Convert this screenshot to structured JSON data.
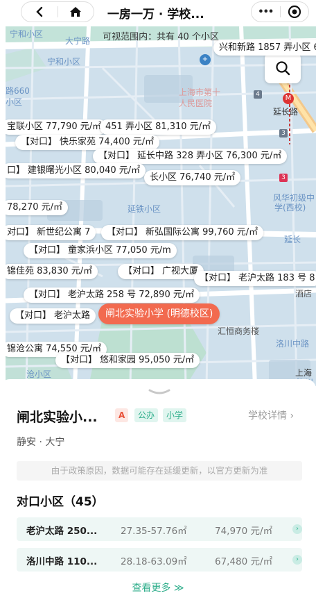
{
  "nav": {
    "title": "一房一万 · 学校...",
    "back_glyph": "<",
    "more_glyph": "•••"
  },
  "map": {
    "range_banner": "可视范围内：共有 40 个小区",
    "streets": [
      "宁和小区",
      "大宁路",
      "宁和小区",
      "路660",
      "小区",
      "上海市第十",
      "人民医院",
      "延长路",
      "延铁小区",
      "风华初级中",
      "学(西校)",
      "延长",
      "汇恒商务楼",
      "洛川中路",
      "上海",
      "酒店",
      "沧小区",
      "洛川"
    ],
    "labels": [
      {
        "text": "兴和新路 1857 弄小区 6"
      },
      {
        "text": "宝联小区 77,790 元/㎡"
      },
      {
        "text": "451 弄小区 81,310 元/㎡"
      },
      {
        "prefix": "【对口】",
        "text": "快乐家苑 74,400 元/㎡"
      },
      {
        "prefix": "【对口】",
        "text": "延长中路 328 弄小区 76,300 元/㎡"
      },
      {
        "prefix": "口】",
        "text": "建银曙光小区 80,040 元/㎡"
      },
      {
        "text": "长小区 76,740 元/㎡"
      },
      {
        "text": "78,270 元/㎡"
      },
      {
        "prefix": "对口】",
        "text": "新世纪公寓 7"
      },
      {
        "prefix": "【对口】",
        "text": "新弘国际公寓 99,760 元/㎡"
      },
      {
        "prefix": "【对口】",
        "text": "童家浜小区 77,050 元/m"
      },
      {
        "text": "锦佳苑 83,830 元/㎡"
      },
      {
        "prefix": "【对口】",
        "text": "广视大厦"
      },
      {
        "prefix": "【对口】",
        "text": "老沪太路 183 号 8"
      },
      {
        "prefix": "【对口】",
        "text": "老沪太路 258 号 72,890 元/㎡"
      },
      {
        "prefix": "【对口】",
        "text": "老沪太路"
      },
      {
        "text": "锦沧公寓 74,550 元/㎡"
      },
      {
        "prefix": "【对口】",
        "text": "悠和家园 95,050 元/㎡"
      }
    ],
    "highlight_label": "闸北实验小学 (明德校区)",
    "poi_badges": [
      "4",
      "3",
      "3"
    ]
  },
  "school": {
    "name": "闸北实验小...",
    "tags": {
      "grade": "A",
      "type": "公办",
      "level": "小学"
    },
    "detail_link": "学校详情 ›",
    "district": "静安 · 大宁",
    "notice": "由于政策原因，数据可能存在延缓更新，以官方更新为准"
  },
  "communities": {
    "title": "对口小区（45）",
    "rows": [
      {
        "name": "老沪太路 250...",
        "area": "27.35-57.76㎡",
        "price": "74,970 元/㎡"
      },
      {
        "name": "洛川中路 110...",
        "area": "28.18-63.09㎡",
        "price": "67,480 元/㎡"
      }
    ],
    "more": "查看更多 ≫"
  },
  "colors": {
    "accent": "#2fae8b",
    "highlight": "#f26a4f",
    "map_bg": "#cfe0ec"
  }
}
